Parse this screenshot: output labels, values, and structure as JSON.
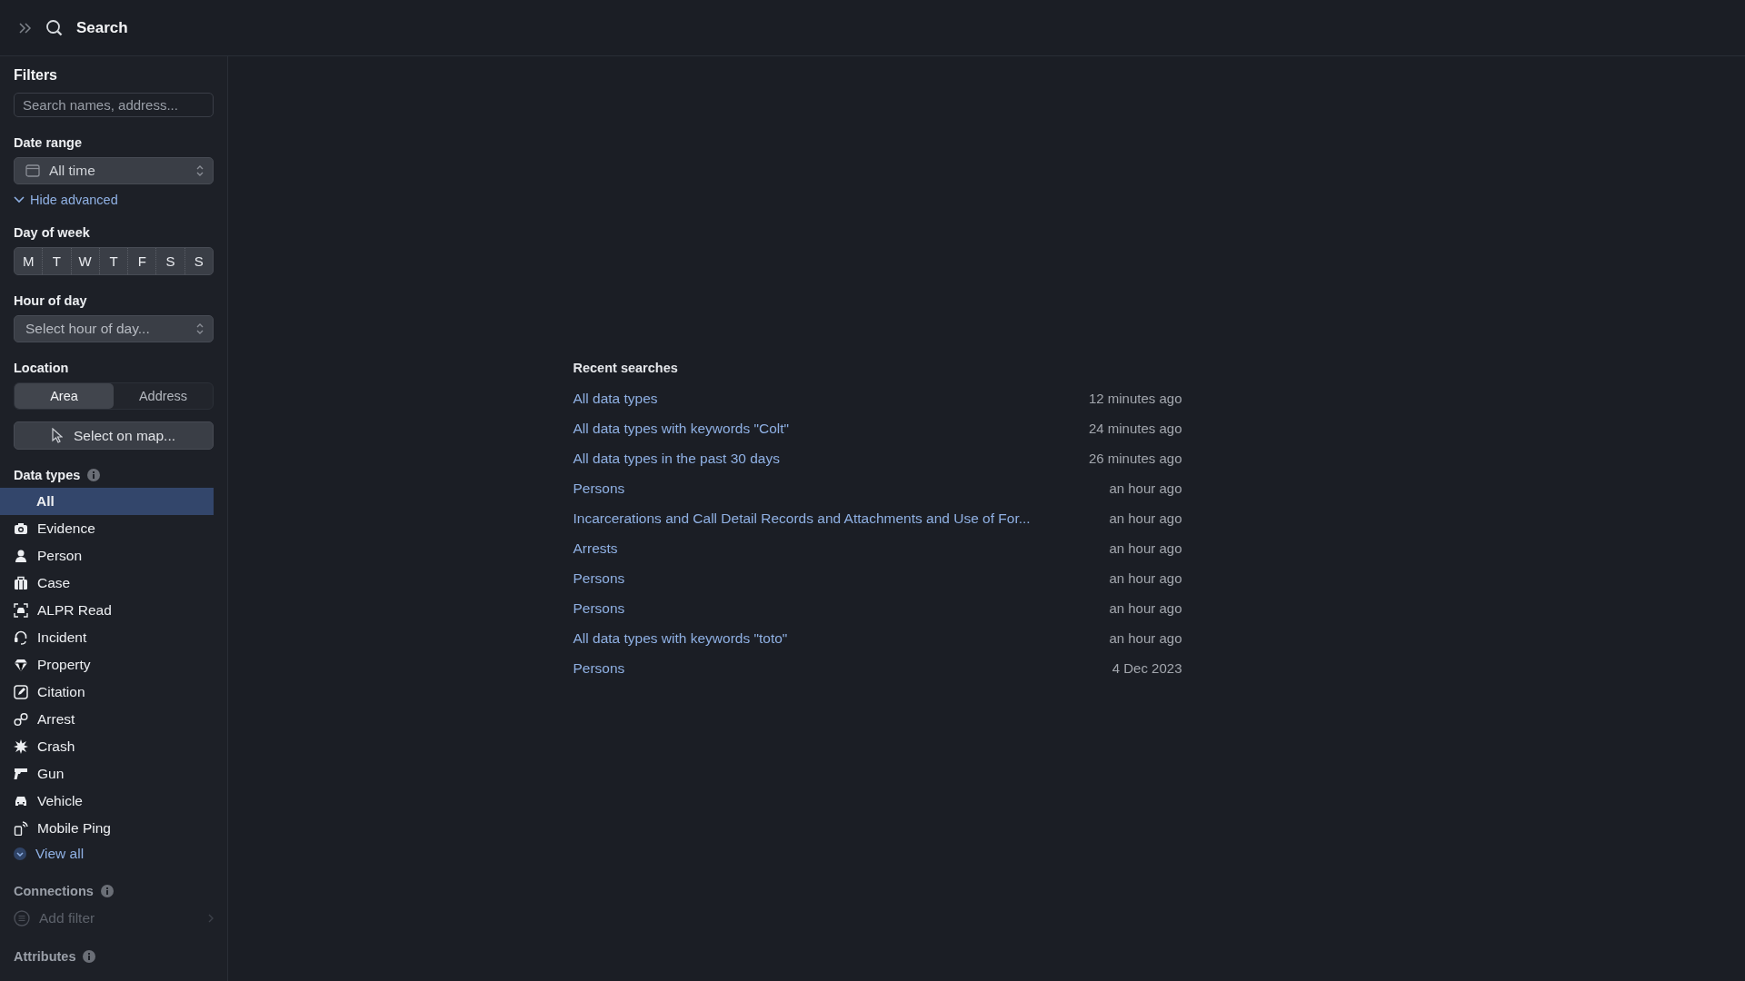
{
  "header": {
    "title": "Search"
  },
  "filters": {
    "title": "Filters",
    "search": {
      "placeholder": "Search names, address..."
    },
    "date_range": {
      "label": "Date range",
      "value": "All time"
    },
    "advanced_toggle": {
      "label": "Hide advanced",
      "expanded": true
    },
    "day_of_week": {
      "label": "Day of week",
      "days": [
        "M",
        "T",
        "W",
        "T",
        "F",
        "S",
        "S"
      ]
    },
    "hour_of_day": {
      "label": "Hour of day",
      "placeholder": "Select hour of day..."
    },
    "location": {
      "label": "Location",
      "modes": [
        {
          "label": "Area",
          "selected": true
        },
        {
          "label": "Address",
          "selected": false
        }
      ],
      "map_button": "Select on map..."
    },
    "data_types": {
      "label": "Data types",
      "items": [
        {
          "label": "All",
          "selected": true
        },
        {
          "label": "Evidence",
          "selected": false
        },
        {
          "label": "Person",
          "selected": false
        },
        {
          "label": "Case",
          "selected": false
        },
        {
          "label": "ALPR Read",
          "selected": false
        },
        {
          "label": "Incident",
          "selected": false
        },
        {
          "label": "Property",
          "selected": false
        },
        {
          "label": "Citation",
          "selected": false
        },
        {
          "label": "Arrest",
          "selected": false
        },
        {
          "label": "Crash",
          "selected": false
        },
        {
          "label": "Gun",
          "selected": false
        },
        {
          "label": "Vehicle",
          "selected": false
        },
        {
          "label": "Mobile Ping",
          "selected": false
        }
      ],
      "view_all": "View all"
    },
    "connections": {
      "label": "Connections",
      "add_filter": "Add filter",
      "disabled": true
    },
    "attributes": {
      "label": "Attributes"
    }
  },
  "recent_searches": {
    "title": "Recent searches",
    "items": [
      {
        "query": "All data types",
        "time": "12 minutes ago"
      },
      {
        "query": "All data types with keywords \"Colt\"",
        "time": "24 minutes ago"
      },
      {
        "query": "All data types in the past 30 days",
        "time": "26 minutes ago"
      },
      {
        "query": "Persons",
        "time": "an hour ago"
      },
      {
        "query": "Incarcerations and Call Detail Records and Attachments and Use of For...",
        "time": "an hour ago"
      },
      {
        "query": "Arrests",
        "time": "an hour ago"
      },
      {
        "query": "Persons",
        "time": "an hour ago"
      },
      {
        "query": "Persons",
        "time": "an hour ago"
      },
      {
        "query": "All data types with keywords \"toto\"",
        "time": "an hour ago"
      },
      {
        "query": "Persons",
        "time": "4 Dec 2023"
      }
    ]
  }
}
